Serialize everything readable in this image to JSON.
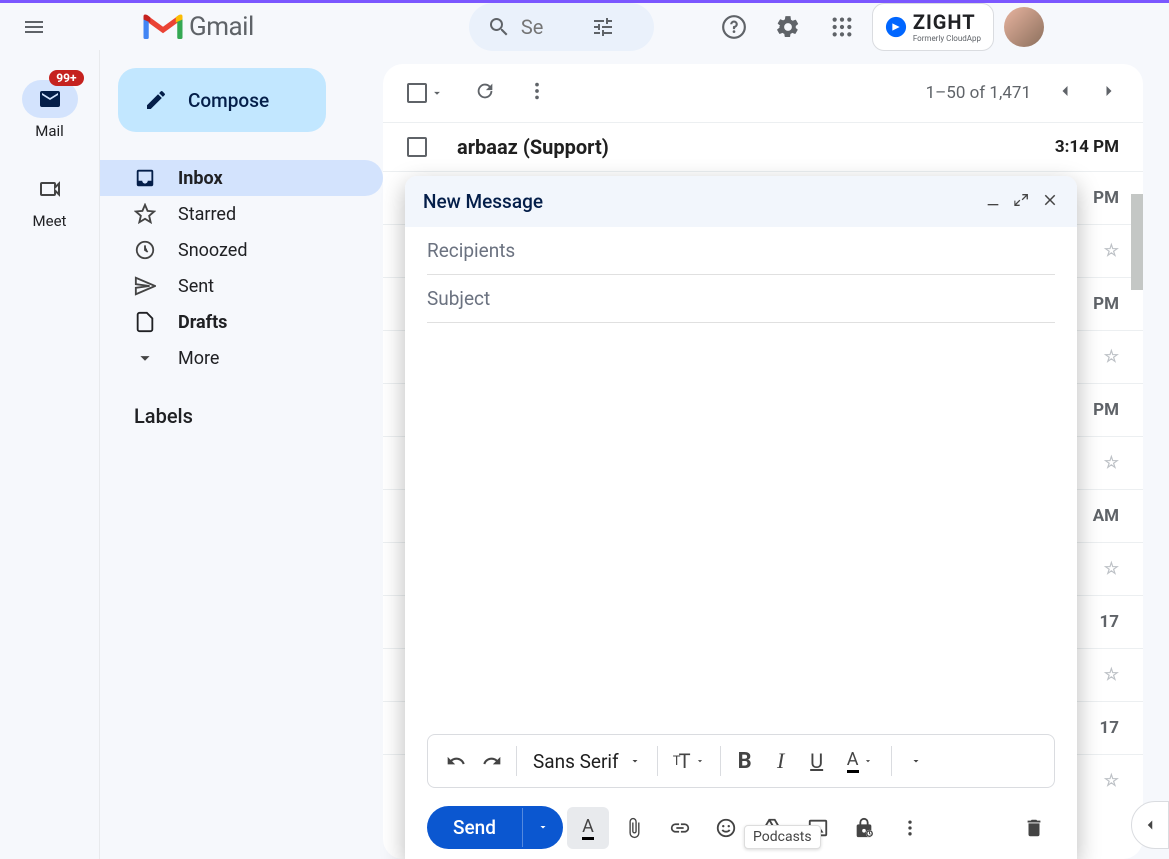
{
  "app": {
    "name": "Gmail"
  },
  "search": {
    "placeholder": "Se"
  },
  "zight": {
    "name": "ZIGHT",
    "sub": "Formerly CloudApp"
  },
  "rail": {
    "mail": "Mail",
    "meet": "Meet",
    "badge": "99+"
  },
  "compose": {
    "label": "Compose"
  },
  "nav": {
    "inbox": "Inbox",
    "starred": "Starred",
    "snoozed": "Snoozed",
    "sent": "Sent",
    "drafts": "Drafts",
    "more": "More"
  },
  "labels": {
    "header": "Labels"
  },
  "toolbar": {
    "range": "1–50 of 1,471"
  },
  "rows": [
    {
      "sender": "arbaaz (Support)",
      "time": "3:14 PM"
    }
  ],
  "peeks": {
    "t1": "PM",
    "t2": "PM",
    "t3": "PM",
    "t4": "AM",
    "t5": "17",
    "t6": "17"
  },
  "cw": {
    "title": "New Message",
    "recipients": "Recipients",
    "subject": "Subject",
    "font": "Sans Serif",
    "send": "Send",
    "tooltip": "Podcasts"
  }
}
